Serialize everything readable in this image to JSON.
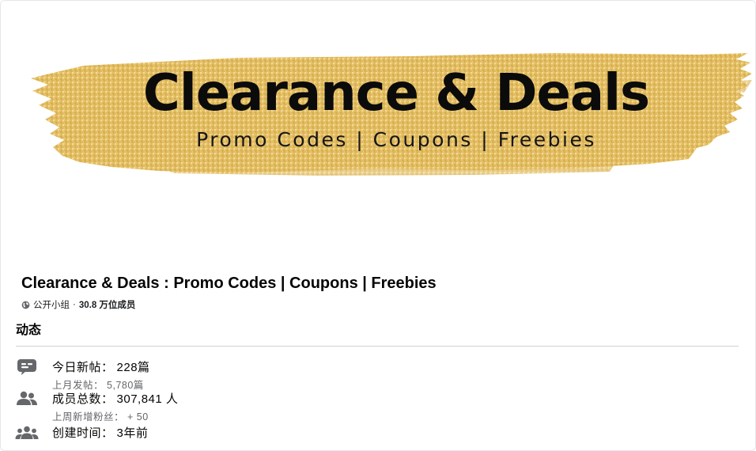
{
  "banner": {
    "title": "Clearance & Deals",
    "subtitle": "Promo Codes | Coupons | Freebies",
    "accent_color": "#e2bd61"
  },
  "group": {
    "name": "Clearance & Deals : Promo Codes | Coupons | Freebies",
    "privacy": "公开小组",
    "separator": "·",
    "members": "30.8 万位成员",
    "privacy_icon": "globe-icon"
  },
  "activity": {
    "title": "动态",
    "stats": [
      {
        "icon": "chat-bubble-icon",
        "label": "今日新帖：",
        "value": "228篇",
        "sub_label": "上月发帖：",
        "sub_value": "5,780篇"
      },
      {
        "icon": "members-icon",
        "label": "成员总数：",
        "value": "307,841 人",
        "sub_label": "上周新增粉丝：",
        "sub_value": "+ 50"
      },
      {
        "icon": "group-icon",
        "label": "创建时间：",
        "value": "3年前"
      }
    ]
  }
}
